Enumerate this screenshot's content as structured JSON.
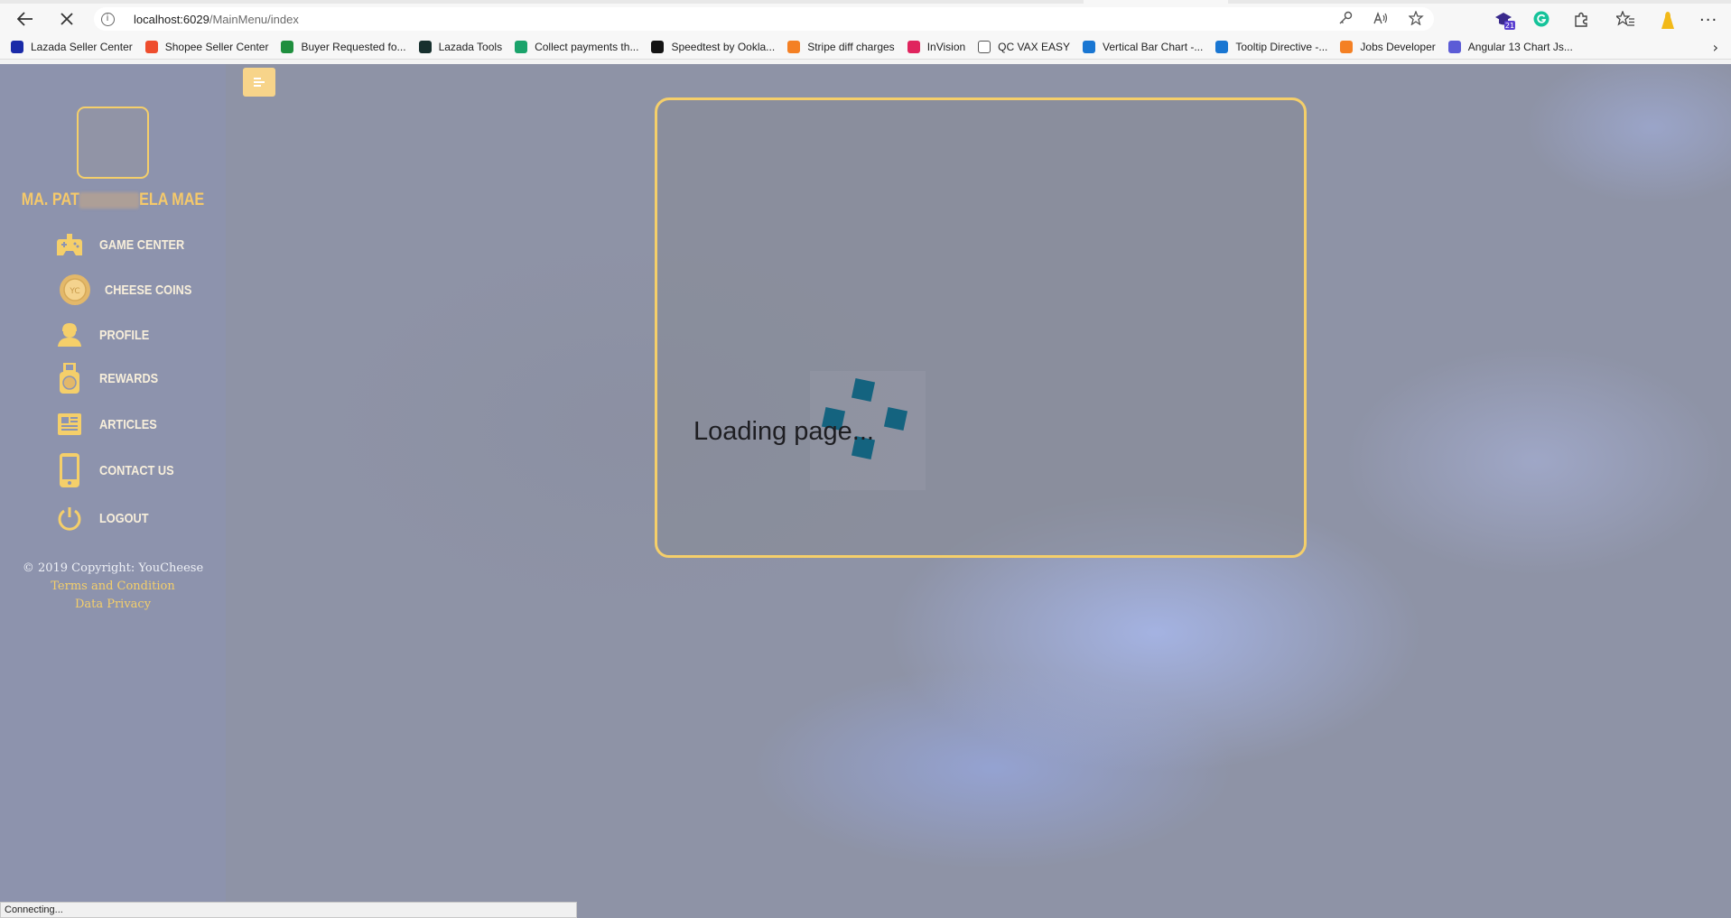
{
  "browser": {
    "url_host": "localhost:6029",
    "url_path": "/MainMenu/index",
    "status_text": "Connecting...",
    "icons": [
      "back-arrow-icon",
      "stop-loading-icon",
      "site-info-icon",
      "password-key-icon",
      "read-aloud-icon",
      "favorites-add-icon",
      "extension-icon",
      "grammarly-icon",
      "extensions-icon",
      "favorites-icon",
      "profile-icon",
      "more-icon"
    ],
    "extension_badge": "21"
  },
  "bookmarks": [
    {
      "label": "Lazada Seller Center",
      "color": "#1a2aa8"
    },
    {
      "label": "Shopee Seller Center",
      "color": "#ee4d2d"
    },
    {
      "label": "Buyer Requested fo...",
      "color": "#1f8f3e"
    },
    {
      "label": "Lazada Tools",
      "color": "#17302e"
    },
    {
      "label": "Collect payments th...",
      "color": "#1aa36b"
    },
    {
      "label": "Speedtest by Ookla...",
      "color": "#141414"
    },
    {
      "label": "Stripe diff charges",
      "color": "#f48024"
    },
    {
      "label": "InVision",
      "color": "#e0245e"
    },
    {
      "label": "QC VAX EASY",
      "color": "#ffffff"
    },
    {
      "label": "Vertical Bar Chart -...",
      "color": "#1976d2"
    },
    {
      "label": "Tooltip Directive -...",
      "color": "#1976d2"
    },
    {
      "label": "Jobs Developer",
      "color": "#f48024"
    },
    {
      "label": "Angular 13 Chart Js...",
      "color": "#5c5cd6"
    }
  ],
  "sidebar": {
    "user_name_start": "MA. PAT",
    "user_name_end": "ELA MAE",
    "items": [
      {
        "label": "GAME CENTER",
        "icon": "gamepad-icon"
      },
      {
        "label": "CHEESE COINS",
        "icon": "coin-icon"
      },
      {
        "label": "PROFILE",
        "icon": "user-icon"
      },
      {
        "label": "REWARDS",
        "icon": "medal-icon"
      },
      {
        "label": "ARTICLES",
        "icon": "newspaper-icon"
      },
      {
        "label": "CONTACT US",
        "icon": "phone-icon"
      },
      {
        "label": "LOGOUT",
        "icon": "power-icon"
      }
    ],
    "footer": {
      "copyright": "© 2019 Copyright: YouCheese",
      "terms": "Terms and Condition",
      "privacy": "Data Privacy"
    }
  },
  "main": {
    "loading_text": "Loading page..."
  },
  "colors": {
    "accent": "#f5cf6a",
    "loader": "#14637f"
  }
}
